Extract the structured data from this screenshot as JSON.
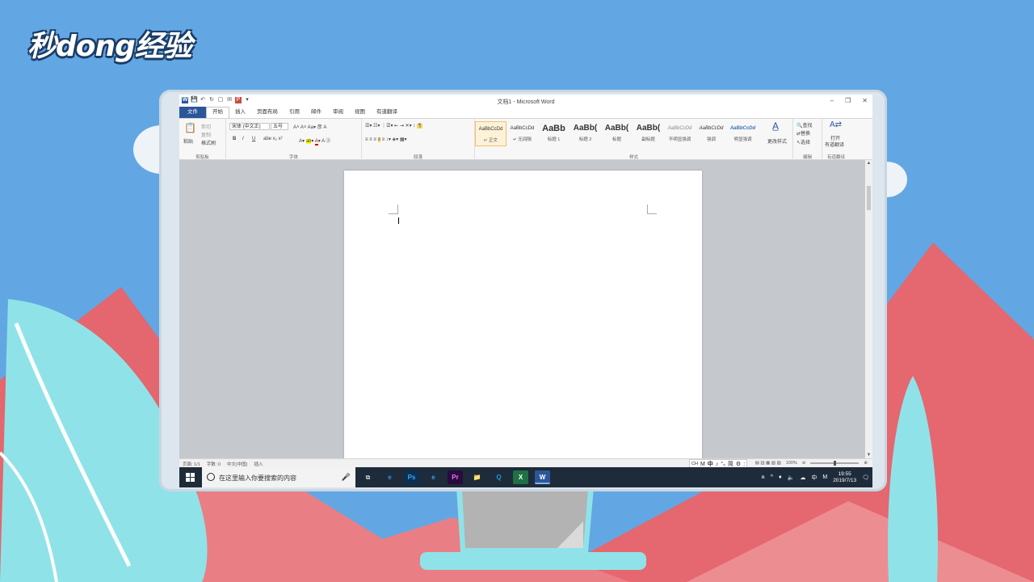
{
  "logo": {
    "text": "秒dong经验"
  },
  "window": {
    "title": "文档1 - Microsoft Word",
    "controls": {
      "minimize": "–",
      "restore": "❐",
      "close": "✕"
    },
    "qat": [
      "W",
      "💾",
      "↶",
      "↻",
      "▢",
      "✉",
      "P",
      "▾"
    ]
  },
  "tabs": [
    {
      "label": "文件"
    },
    {
      "label": "开始"
    },
    {
      "label": "插入"
    },
    {
      "label": "页面布局"
    },
    {
      "label": "引用"
    },
    {
      "label": "邮件"
    },
    {
      "label": "审阅"
    },
    {
      "label": "视图"
    },
    {
      "label": "有道翻译"
    }
  ],
  "ribbon": {
    "clipboard": {
      "paste": "粘贴",
      "cut": "剪切",
      "copy": "复制",
      "format_painter": "格式刷",
      "label": "剪贴板"
    },
    "font": {
      "font_name": "宋体 (中文正)",
      "font_size": "五号",
      "label": "字体",
      "bold": "B",
      "italic": "I",
      "underline": "U"
    },
    "paragraph": {
      "label": "段落"
    },
    "styles": {
      "label": "样式",
      "items": [
        {
          "sample": "AaBbCcDd",
          "name": "↵ 正文"
        },
        {
          "sample": "AaBbCcDd",
          "name": "↵ 无间隔"
        },
        {
          "sample": "AaBb",
          "name": "标题 1"
        },
        {
          "sample": "AaBb(",
          "name": "标题 2"
        },
        {
          "sample": "AaBb(",
          "name": "标题"
        },
        {
          "sample": "AaBb(",
          "name": "副标题"
        },
        {
          "sample": "AaBbCcDd",
          "name": "不明显强调"
        },
        {
          "sample": "AaBbCcDd",
          "name": "强调"
        },
        {
          "sample": "AaBbCcDd",
          "name": "明显强调"
        }
      ],
      "change_styles": "更改样式"
    },
    "editing": {
      "find": "查找",
      "replace": "替换",
      "select": "选择",
      "label": "编辑"
    },
    "youdao": {
      "open": "打开",
      "translate": "有道翻译",
      "label": "有道翻译"
    }
  },
  "statusbar": {
    "page": "页面: 1/1",
    "words": "字数: 0",
    "language": "中文(中国)",
    "mode": "插入",
    "ime": [
      "CH",
      "M",
      "中",
      "♪",
      "°₅",
      "简",
      "⚙",
      ":"
    ],
    "zoom": "100%"
  },
  "taskbar": {
    "search_placeholder": "在这里输入你要搜索的内容",
    "apps": [
      "Ps",
      "e",
      "Pr",
      "📁",
      "Q",
      "X",
      "W"
    ],
    "tray": {
      "lang": "中",
      "ime": "M",
      "time": "19:55",
      "date": "2019/7/13"
    }
  },
  "colors": {
    "sky": "#62a7e3",
    "mountain": "#e5676f",
    "plant": "#8fe3e8",
    "word_blue": "#2b579a",
    "taskbar": "#1e2b3a"
  }
}
